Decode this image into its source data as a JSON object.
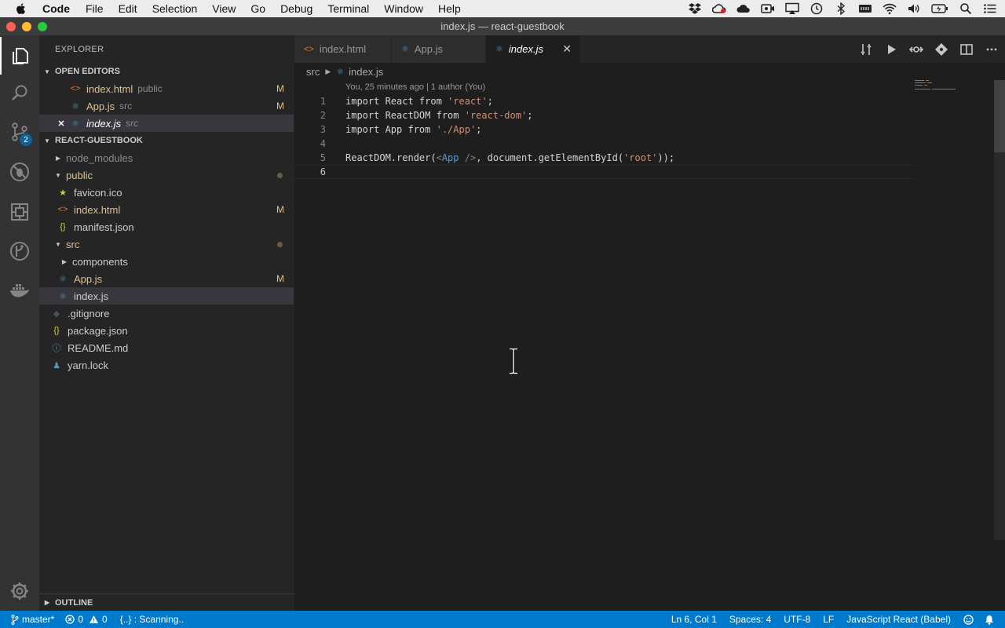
{
  "menubar": {
    "app_name": "Code",
    "items": [
      "File",
      "Edit",
      "Selection",
      "View",
      "Go",
      "Debug",
      "Terminal",
      "Window",
      "Help"
    ]
  },
  "window": {
    "title": "index.js — react-guestbook"
  },
  "activity": {
    "scm_badge": "2"
  },
  "sidebar": {
    "title": "EXPLORER",
    "open_editors": {
      "header": "OPEN EDITORS",
      "items": [
        {
          "name": "index.html",
          "desc": "public",
          "decoration": "M"
        },
        {
          "name": "App.js",
          "desc": "src",
          "decoration": "M"
        },
        {
          "name": "index.js",
          "desc": "src",
          "decoration": ""
        }
      ]
    },
    "project": {
      "header": "REACT-GUESTBOOK",
      "items": [
        {
          "name": "node_modules",
          "decoration": ""
        },
        {
          "name": "public",
          "decoration": ""
        },
        {
          "name": "favicon.ico",
          "decoration": ""
        },
        {
          "name": "index.html",
          "decoration": "M"
        },
        {
          "name": "manifest.json",
          "decoration": ""
        },
        {
          "name": "src",
          "decoration": ""
        },
        {
          "name": "components",
          "decoration": ""
        },
        {
          "name": "App.js",
          "decoration": "M"
        },
        {
          "name": "index.js",
          "decoration": ""
        },
        {
          "name": ".gitignore",
          "decoration": ""
        },
        {
          "name": "package.json",
          "decoration": ""
        },
        {
          "name": "README.md",
          "decoration": ""
        },
        {
          "name": "yarn.lock",
          "decoration": ""
        }
      ]
    },
    "outline_header": "OUTLINE"
  },
  "tabs": [
    {
      "label": "index.html"
    },
    {
      "label": "App.js"
    },
    {
      "label": "index.js",
      "close": "✕"
    }
  ],
  "breadcrumb": {
    "folder": "src",
    "file": "index.js"
  },
  "editor": {
    "codelens": "You, 25 minutes ago | 1 author (You)",
    "line_numbers": [
      "1",
      "2",
      "3",
      "4",
      "5",
      "6"
    ],
    "lines": [
      {
        "a": "import React from ",
        "s": "'react'",
        "b": ";"
      },
      {
        "a": "import ReactDOM from ",
        "s": "'react-dom'",
        "b": ";"
      },
      {
        "a": "import App from ",
        "s": "'./App'",
        "b": ";"
      },
      {
        "a": "",
        "s": "",
        "b": ""
      },
      {
        "a": "ReactDOM.render(",
        "t1": "<",
        "t2": "App",
        "t3": " />",
        "c": ", document.getElementById(",
        "s": "'root'",
        "b": "));"
      },
      {
        "a": "",
        "s": "",
        "b": ""
      }
    ]
  },
  "statusbar": {
    "branch": "master*",
    "errors": "0",
    "warnings": "0",
    "scanning": "{..} : Scanning..",
    "position": "Ln 6, Col 1",
    "spaces": "Spaces: 4",
    "encoding": "UTF-8",
    "eol": "LF",
    "language": "JavaScript React (Babel)"
  },
  "colors": {
    "accent": "#007acc",
    "modified": "#e2c08d",
    "string": "#ce9178",
    "keyword_tag": "#569cd6"
  }
}
